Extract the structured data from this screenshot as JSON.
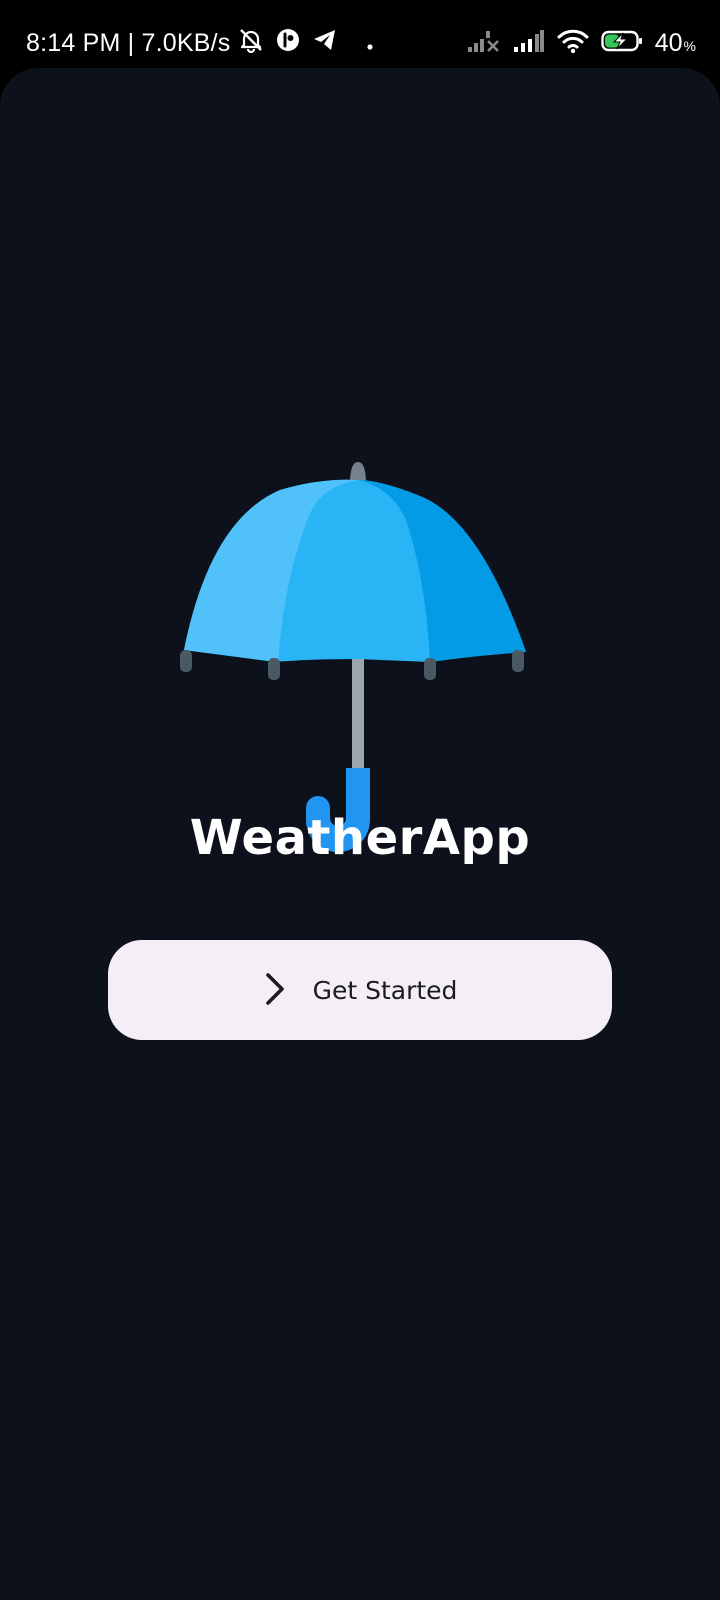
{
  "status_bar": {
    "time_speed": "8:14 PM | 7.0KB/s",
    "left_icons": [
      "bell-off-icon",
      "user-circle-icon",
      "telegram-icon",
      "dot-icon"
    ],
    "right_icons": [
      "signal-no-sim-icon",
      "signal-icon",
      "wifi-icon",
      "battery-charging-icon"
    ],
    "battery_value": "40",
    "battery_unit": "%"
  },
  "app": {
    "background_color": "#0c111c",
    "logo_icon": "umbrella-icon",
    "title": "WeatherApp",
    "get_started": {
      "label": "Get Started",
      "icon": "chevron-right-icon"
    }
  }
}
